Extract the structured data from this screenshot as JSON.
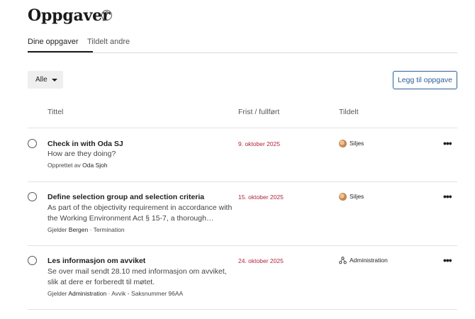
{
  "header": {
    "title": "Oppgaver",
    "help_icon": "question-circle-icon"
  },
  "tabs": [
    {
      "label": "Dine oppgaver",
      "active": true
    },
    {
      "label": "Tildelt andre",
      "active": false
    }
  ],
  "filter": {
    "selected": "Alle"
  },
  "add_button": {
    "label": "Legg til oppgave"
  },
  "columns": {
    "title": "Tittel",
    "due": "Frist / fullført",
    "assigned": "Tildelt"
  },
  "tasks": [
    {
      "title": "Check in with Oda SJ",
      "description": "How are they doing?",
      "meta_prefix": "Opprettet av",
      "meta_strong": "Oda Sjoh",
      "meta_suffix": "",
      "due": "9. oktober 2025",
      "assignee": "Siljes",
      "assignee_icon": "avatar-icon"
    },
    {
      "title": "Define selection group and selection criteria",
      "description": "As part of the objectivity requirement in accordance with the Working Environment Act § 15-7, a thorough selection process is required.",
      "meta_prefix": "Gjelder",
      "meta_strong": "Bergen",
      "meta_suffix": "· Termination",
      "due": "15. oktober 2025",
      "assignee": "Siljes",
      "assignee_icon": "avatar-icon"
    },
    {
      "title": "Les informasjon om avviket",
      "description": "Se over mail sendt 28.10 med informasjon om avviket, slik at dere er forberedt til møtet.",
      "meta_prefix": "Gjelder",
      "meta_strong": "Administration",
      "meta_suffix": "· Avvik - Saksnummer 96AA",
      "due": "24. oktober 2025",
      "assignee": "Administration",
      "assignee_icon": "org-group-icon"
    }
  ],
  "colors": {
    "accent": "#2e5f94",
    "due": "#b0243b"
  },
  "more_icon": "more-horizontal-icon"
}
